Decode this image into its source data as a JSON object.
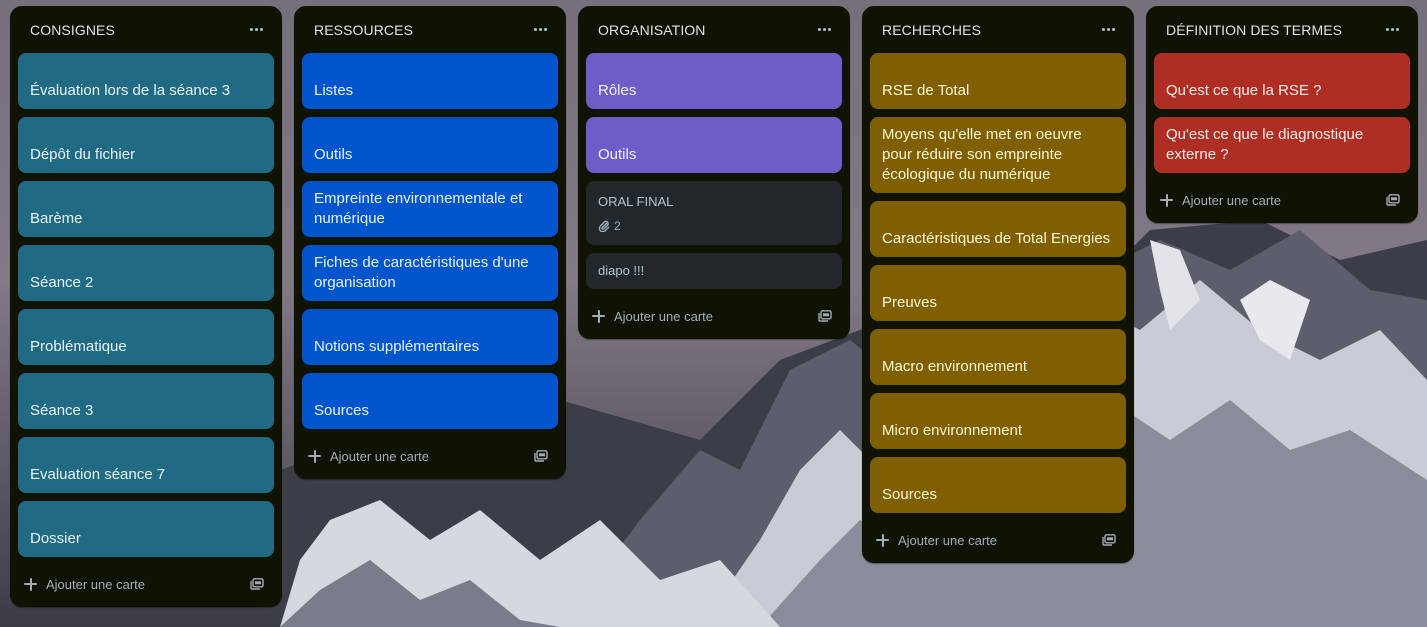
{
  "board": {
    "add_card_label": "Ajouter une carte",
    "lists": [
      {
        "title": "CONSIGNES",
        "cards": [
          {
            "text": "Évaluation lors de la séance 3",
            "color": "#206a83"
          },
          {
            "text": "Dépôt du fichier",
            "color": "#206a83"
          },
          {
            "text": "Barème",
            "color": "#206a83"
          },
          {
            "text": "Séance 2",
            "color": "#206a83"
          },
          {
            "text": "Problématique",
            "color": "#206a83"
          },
          {
            "text": "Séance 3",
            "color": "#206a83"
          },
          {
            "text": "Evaluation séance 7",
            "color": "#206a83"
          },
          {
            "text": "Dossier",
            "color": "#206a83"
          }
        ]
      },
      {
        "title": "RESSOURCES",
        "cards": [
          {
            "text": "Listes",
            "color": "#0055cc"
          },
          {
            "text": "Outils",
            "color": "#0055cc"
          },
          {
            "text": "Empreinte environnementale et numérique",
            "color": "#0055cc"
          },
          {
            "text": "Fiches de caractéristiques d'une organisation",
            "color": "#0055cc"
          },
          {
            "text": "Notions supplémentaires",
            "color": "#0055cc"
          },
          {
            "text": "Sources",
            "color": "#0055cc"
          }
        ]
      },
      {
        "title": "ORGANISATION",
        "cards": [
          {
            "text": "Rôles",
            "color": "#6e5dc6"
          },
          {
            "text": "Outils",
            "color": "#6e5dc6"
          },
          {
            "text": "ORAL FINAL",
            "attachments": "2",
            "icon": "paperclip-icon"
          },
          {
            "text": "diapo !!!"
          }
        ]
      },
      {
        "title": "RECHERCHES",
        "cards": [
          {
            "text": "RSE de Total",
            "color": "#7f5f01"
          },
          {
            "text": "Moyens qu'elle met en oeuvre pour réduire son empreinte écologique du numérique",
            "color": "#7f5f01"
          },
          {
            "text": "Caractéristiques de Total Energies",
            "color": "#7f5f01"
          },
          {
            "text": "Preuves",
            "color": "#7f5f01"
          },
          {
            "text": "Macro environnement",
            "color": "#7f5f01"
          },
          {
            "text": "Micro environnement",
            "color": "#7f5f01"
          },
          {
            "text": "Sources",
            "color": "#7f5f01"
          }
        ]
      },
      {
        "title": "DÉFINITION DES TERMES",
        "cards": [
          {
            "text": "Qu'est ce que la RSE ?",
            "color": "#ae2e24"
          },
          {
            "text": "Qu'est ce que le diagnostique externe ?",
            "color": "#ae2e24"
          }
        ]
      }
    ]
  }
}
